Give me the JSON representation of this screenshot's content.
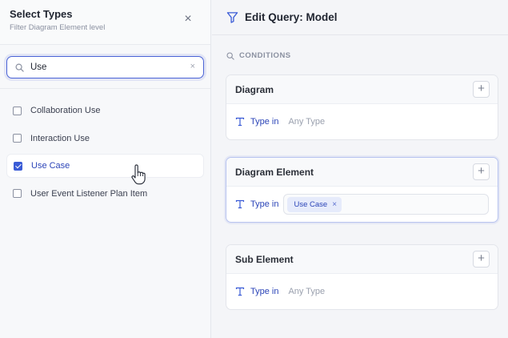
{
  "left_panel": {
    "title": "Select Types",
    "subtitle": "Filter Diagram Element level",
    "close_glyph": "×",
    "search": {
      "value": "Use",
      "clear_glyph": "×"
    },
    "items": [
      {
        "label": "Collaboration Use",
        "checked": false
      },
      {
        "label": "Interaction Use",
        "checked": false
      },
      {
        "label": "Use Case",
        "checked": true
      },
      {
        "label": "User Event Listener Plan Item",
        "checked": false
      }
    ]
  },
  "right_panel": {
    "title": "Edit Query: Model",
    "conditions_label": "CONDITIONS",
    "plus_glyph": "+",
    "cards": [
      {
        "title": "Diagram",
        "type_in_label": "Type in",
        "placeholder": "Any Type"
      },
      {
        "title": "Diagram Element",
        "type_in_label": "Type in",
        "chip": "Use Case",
        "chip_remove": "×"
      },
      {
        "title": "Sub Element",
        "type_in_label": "Type in",
        "placeholder": "Any Type"
      }
    ]
  },
  "colors": {
    "accent": "#3a5bd6",
    "selected_text": "#2c45b8",
    "chip_bg": "#e6ebfb"
  },
  "icons": [
    "close-icon",
    "search-icon",
    "clear-icon",
    "filter-icon",
    "text-type-icon",
    "plus-icon",
    "pointer-cursor-icon"
  ]
}
